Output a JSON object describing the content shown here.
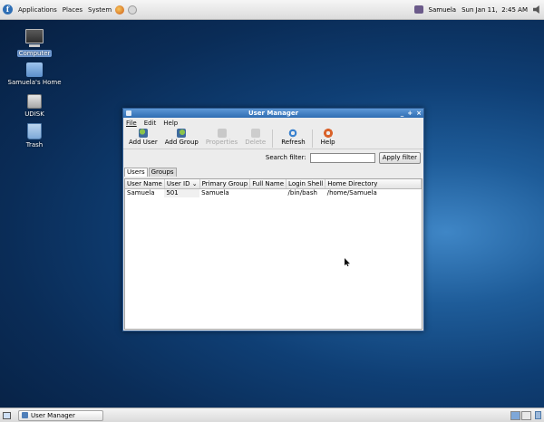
{
  "top_panel": {
    "menus": [
      "Applications",
      "Places",
      "System"
    ],
    "username": "Samuela",
    "clock": "Sun Jan 11,  2:45 AM"
  },
  "desktop_icons": [
    {
      "label": "Computer"
    },
    {
      "label": "Samuela's Home"
    },
    {
      "label": "UDISK"
    },
    {
      "label": "Trash"
    }
  ],
  "window": {
    "title": "User Manager",
    "controls": [
      "_",
      "+",
      "×"
    ],
    "menu": [
      "File",
      "Edit",
      "Help"
    ],
    "toolbar": {
      "add_user": "Add User",
      "add_group": "Add Group",
      "properties": "Properties",
      "delete": "Delete",
      "refresh": "Refresh",
      "help": "Help"
    },
    "search": {
      "label": "Search filter:",
      "value": "",
      "button": "Apply filter"
    },
    "tabs": [
      "Users",
      "Groups"
    ],
    "columns": [
      "User Name",
      "User ID",
      "Primary Group",
      "Full Name",
      "Login Shell",
      "Home Directory"
    ],
    "rows": [
      [
        "Samuela",
        "501",
        "Samuela",
        "",
        "/bin/bash",
        "/home/Samuela"
      ]
    ]
  },
  "bottom_panel": {
    "task": "User Manager"
  },
  "colors": {
    "titlebar": "#2f6db2",
    "desktop": "#0f3f75"
  }
}
